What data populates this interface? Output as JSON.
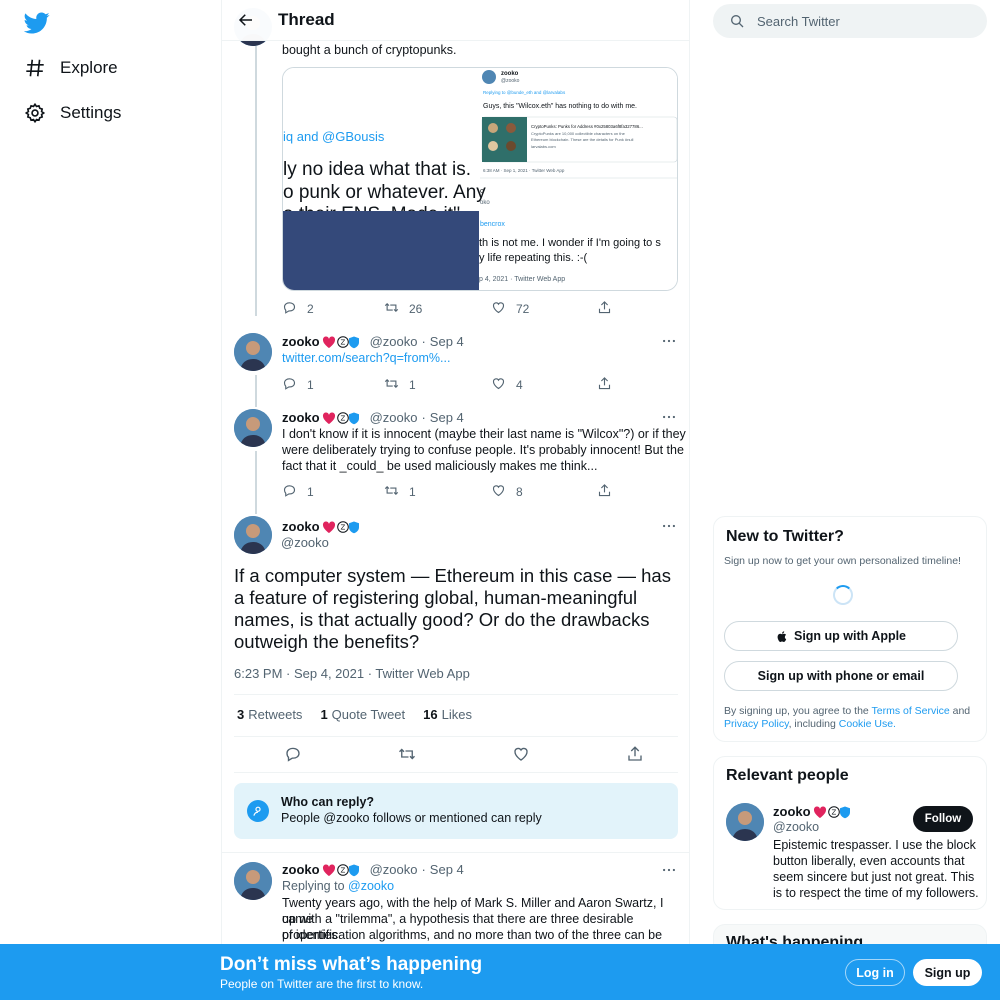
{
  "nav": {
    "explore": "Explore",
    "settings": "Settings"
  },
  "header": {
    "title": "Thread"
  },
  "tweet0": {
    "text": "bought a bunch of cryptopunks.",
    "actions": {
      "replies": "2",
      "retweets": "26",
      "likes": "72"
    },
    "media": {
      "left_lines": [
        "iq and @GBousis",
        "ly no idea what that is.",
        "o punk or whatever. Any",
        "th is not me. I wonder if I'm going to s",
        "y life repeating this. :-(",
        "p 4, 2021 · Twitter Web App",
        "bencrox"
      ],
      "quoted_handle": "@zooko",
      "quoted_reply": "Replying to @bunde_eth and @larvalabs",
      "quoted_text": "Guys, this \"Wilcox.eth\" has nothing to do with me.",
      "card_title": "CryptoPunks: Punks for Address #0x25803a6f8fa327786...",
      "card_desc": "CryptoPunks are 10,000 collectible characters on the Ethereum blockchain. These are the details for Punk #null",
      "card_domain": "larvalabs.com",
      "quoted_meta": "6:38 AM · Sep 1, 2021 · Twitter Web App"
    }
  },
  "tweet1": {
    "name": "zooko",
    "handle": "@zooko",
    "sep": "·",
    "date": "Sep 4",
    "link": "twitter.com/search?q=from%...",
    "actions": {
      "replies": "1",
      "retweets": "1",
      "likes": "4"
    }
  },
  "tweet2": {
    "name": "zooko",
    "handle": "@zooko",
    "sep": "·",
    "date": "Sep 4",
    "lines": [
      "I don't know if it is innocent (maybe their last name is \"Wilcox\"?) or if they",
      "were deliberately trying to confuse people. It's probably innocent! But the",
      "fact that it _could_ be used maliciously makes me think..."
    ],
    "actions": {
      "replies": "1",
      "retweets": "1",
      "likes": "8"
    }
  },
  "main_tweet": {
    "name": "zooko",
    "handle": "@zooko",
    "text": "If a computer system — Ethereum in this case — has a feature of registering global, human-meaningful names, is that actually good? Or do the drawbacks outweigh the benefits?",
    "meta": "6:23 PM · Sep 4, 2021 · Twitter Web App",
    "stats": {
      "retweets_n": "3",
      "retweets_l": "Retweets",
      "quotes_n": "1",
      "quotes_l": "Quote Tweet",
      "likes_n": "16",
      "likes_l": "Likes"
    }
  },
  "who_can_reply": {
    "title": "Who can reply?",
    "subtitle": "People @zooko follows or mentioned can reply"
  },
  "reply_tweet": {
    "name": "zooko",
    "handle": "@zooko",
    "sep": "·",
    "date": "Sep 4",
    "replying_label": "Replying to",
    "replying_handle": "@zooko",
    "lines": [
      "Twenty years ago, with the help of Mark S. Miller and Aaron Swartz, I came",
      "up with a \"trilemma\", a hypothesis that there are three desirable properties",
      "of identification algorithms, and no more than two of the three can be"
    ]
  },
  "search": {
    "placeholder": "Search Twitter"
  },
  "new_to_twitter": {
    "title": "New to Twitter?",
    "subtitle": "Sign up now to get your own personalized timeline!",
    "apple": "Sign up with Apple",
    "phone": "Sign up with phone or email",
    "terms_1": "By signing up, you agree to the",
    "terms_link": "Terms of Service",
    "terms_2": "and",
    "privacy_link": "Privacy Policy",
    "terms_3": ", including",
    "cookie_link": "Cookie Use."
  },
  "relevant_people": {
    "title": "Relevant people",
    "name": "zooko",
    "handle": "@zooko",
    "follow": "Follow",
    "bio": [
      "Epistemic trespasser. I use the block",
      "button liberally, even accounts that",
      "seem sincere but just not great. This",
      "is to respect the time of my followers."
    ]
  },
  "whats_happening": {
    "title": "What's happening"
  },
  "banner": {
    "title": "Don’t miss what’s happening",
    "subtitle": "People on Twitter are the first to know.",
    "login": "Log in",
    "signup": "Sign up"
  },
  "colors": {
    "brand": "#1d9bf0",
    "text": "#0f1419",
    "muted": "#536471",
    "heart": "#f91880"
  }
}
